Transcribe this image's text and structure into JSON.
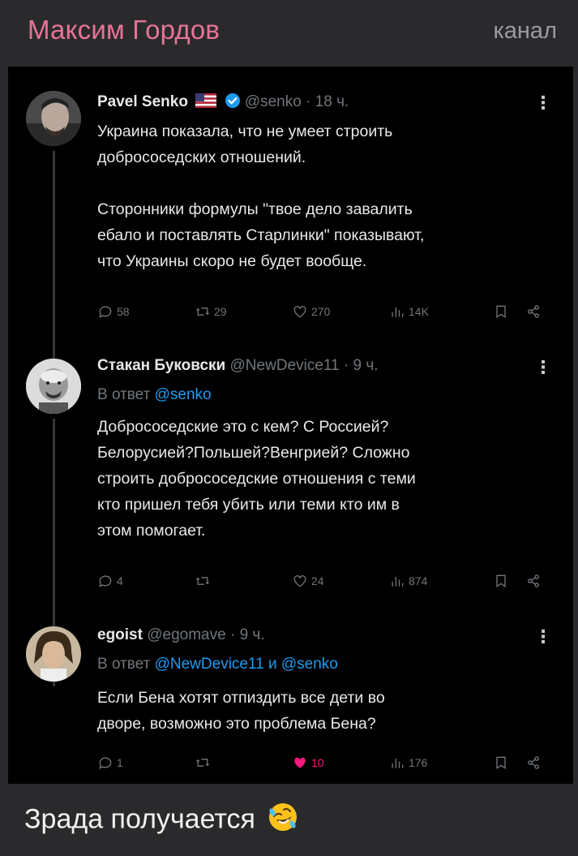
{
  "header": {
    "channel_name": "Максим Гордов",
    "channel_tag": "канал"
  },
  "tweets": [
    {
      "name": "Pavel Senko",
      "meta": "@senko · 18 ч.",
      "reply_prefix": "",
      "reply_mentions": "",
      "text": "Украина показала, что не умеет строить\nдобрососедских отношений.\n\nСторонники формулы \"твое дело завалить\nебало и поставлять Старлинки\" показывают,\nчто Украины скоро не будет вообще.",
      "stats": {
        "replies": "58",
        "retweets": "29",
        "likes": "270",
        "views": "14K"
      }
    },
    {
      "name": "Стакан Буковски",
      "meta": "@NewDevice11 · 9 ч.",
      "reply_prefix": "В ответ",
      "reply_mentions": "@senko",
      "text": "Добрососедские это с кем? С Россией?\nБелорусией?Польшей?Венгрией? Сложно\nстроить добрососедские отношения с теми\nкто пришел тебя убить или теми кто им в\nэтом помогает.",
      "stats": {
        "replies": "4",
        "retweets": "",
        "likes": "24",
        "views": "874"
      }
    },
    {
      "name": "egoist",
      "meta": "@egomave · 9 ч.",
      "reply_prefix": "В ответ",
      "reply_mentions": "@NewDevice11 и @senko",
      "text": "Если Бена хотят отпиздить все дети во\nдворе, возможно это проблема Бена?",
      "stats": {
        "replies": "1",
        "retweets": "",
        "likes": "10",
        "views": "176"
      }
    }
  ],
  "caption": "Зрада получается",
  "colors": {
    "channel_name": "#e6739a",
    "link": "#1d9bf0",
    "like_active": "#f91880",
    "verified": "#1d9bf0"
  }
}
